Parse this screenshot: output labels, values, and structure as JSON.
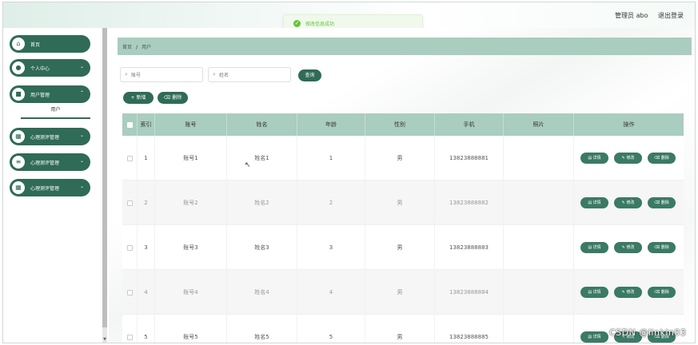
{
  "header": {
    "title": "",
    "user_label": "管理员 abo",
    "logout_label": "退出登录"
  },
  "toast": {
    "message": "修改信息成功"
  },
  "sidebar": {
    "items": [
      {
        "label": "首页",
        "icon": "home-icon"
      },
      {
        "label": "个人中心",
        "icon": "user-icon"
      },
      {
        "label": "用户管理",
        "icon": "folder-icon"
      },
      {
        "label": "心理测评管理",
        "icon": "grid-icon"
      },
      {
        "label": "心理测评管理",
        "icon": "list-icon"
      },
      {
        "label": "心理测评管理",
        "icon": "grid-icon"
      }
    ],
    "submenu_label": "用户"
  },
  "breadcrumb": {
    "home": "首页",
    "separator": "/",
    "current": "用户"
  },
  "search": {
    "account_placeholder": "账号",
    "name_placeholder": "姓名",
    "query_label": "查询"
  },
  "toolbar": {
    "add_label": "+ 新增",
    "delete_label": "删除"
  },
  "table": {
    "headers": {
      "index": "索引",
      "account": "账号",
      "name": "姓名",
      "age": "年龄",
      "gender": "性别",
      "phone": "手机",
      "photo": "照片",
      "actions": "操作"
    },
    "rows": [
      {
        "index": "1",
        "account": "账号1",
        "name": "姓名1",
        "age": "1",
        "gender": "男",
        "phone": "13823888881"
      },
      {
        "index": "2",
        "account": "账号2",
        "name": "姓名2",
        "age": "2",
        "gender": "男",
        "phone": "13823888882"
      },
      {
        "index": "3",
        "account": "账号3",
        "name": "姓名3",
        "age": "3",
        "gender": "男",
        "phone": "13823888883"
      },
      {
        "index": "4",
        "account": "账号4",
        "name": "姓名4",
        "age": "4",
        "gender": "男",
        "phone": "13823888884"
      },
      {
        "index": "5",
        "account": "账号5",
        "name": "姓名5",
        "age": "5",
        "gender": "男",
        "phone": "13823888885"
      }
    ],
    "actions": {
      "detail": "详情",
      "edit": "修改",
      "delete": "删除"
    }
  },
  "watermark": "CSDN @linkin03",
  "colors": {
    "primary": "#2f6b56",
    "header_bg": "#a9cdbf",
    "toast_text": "#67c23a"
  }
}
